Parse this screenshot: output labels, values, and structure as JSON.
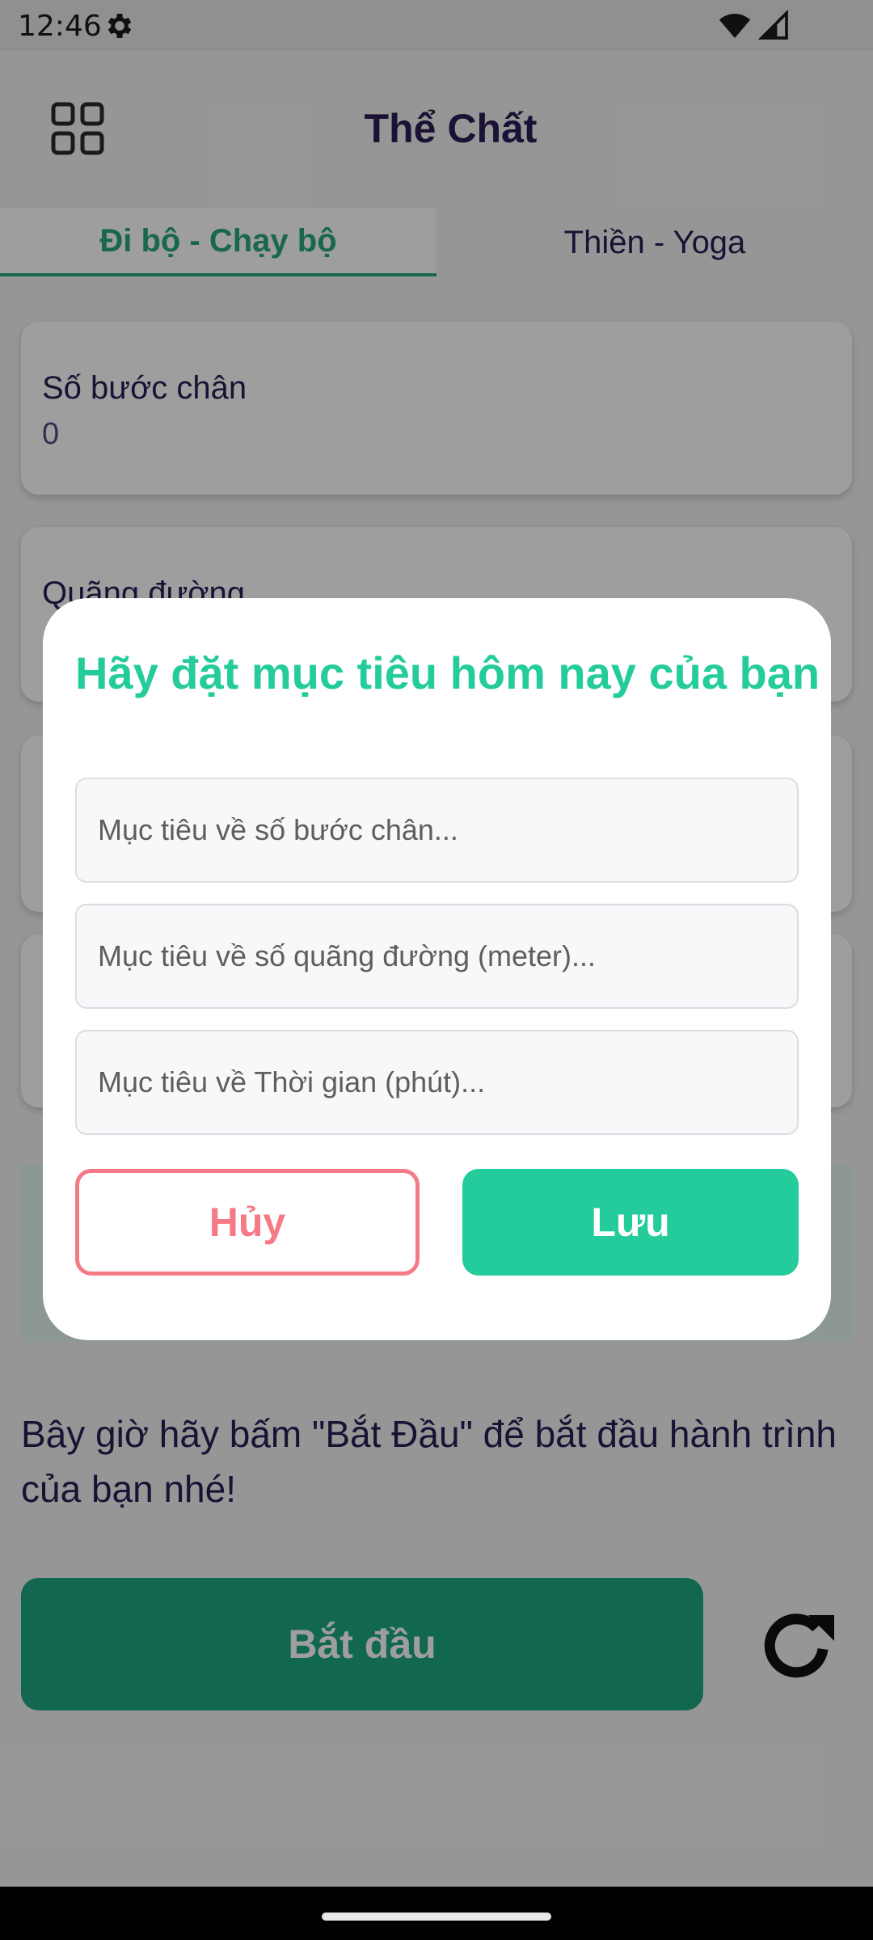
{
  "status_bar": {
    "time": "12:46",
    "icons": [
      "settings-gear-icon",
      "wifi-icon",
      "cell-signal-icon"
    ]
  },
  "app_bar": {
    "title": "Thể Chất",
    "menu_icon": "grid-menu-icon"
  },
  "tabs": [
    {
      "label": "Đi bộ - Chạy bộ",
      "selected": true
    },
    {
      "label": "Thiền - Yoga",
      "selected": false
    }
  ],
  "stats": [
    {
      "label": "Số bước chân",
      "value": "0"
    },
    {
      "label": "Quãng đường",
      "value": ""
    }
  ],
  "instruction": "Bây giờ hãy bấm \"Bắt Đầu\" để bắt đầu hành trình của bạn nhé!",
  "start_button": "Bắt đầu",
  "refresh_icon": "refresh-icon",
  "dialog": {
    "title": "Hãy đặt mục tiêu hôm nay của bạn",
    "fields": [
      {
        "value": "",
        "placeholder": "Mục tiêu về số bước chân..."
      },
      {
        "value": "",
        "placeholder": "Mục tiêu về số quãng đường (meter)..."
      },
      {
        "value": "",
        "placeholder": "Mục tiêu về Thời gian (phút)..."
      }
    ],
    "cancel_label": "Hủy",
    "save_label": "Lưu"
  },
  "colors": {
    "accent_green": "#24cc9b",
    "primary_dark": "#2b1c55",
    "cancel_red": "#f47b86",
    "start_green": "#1ea683"
  }
}
